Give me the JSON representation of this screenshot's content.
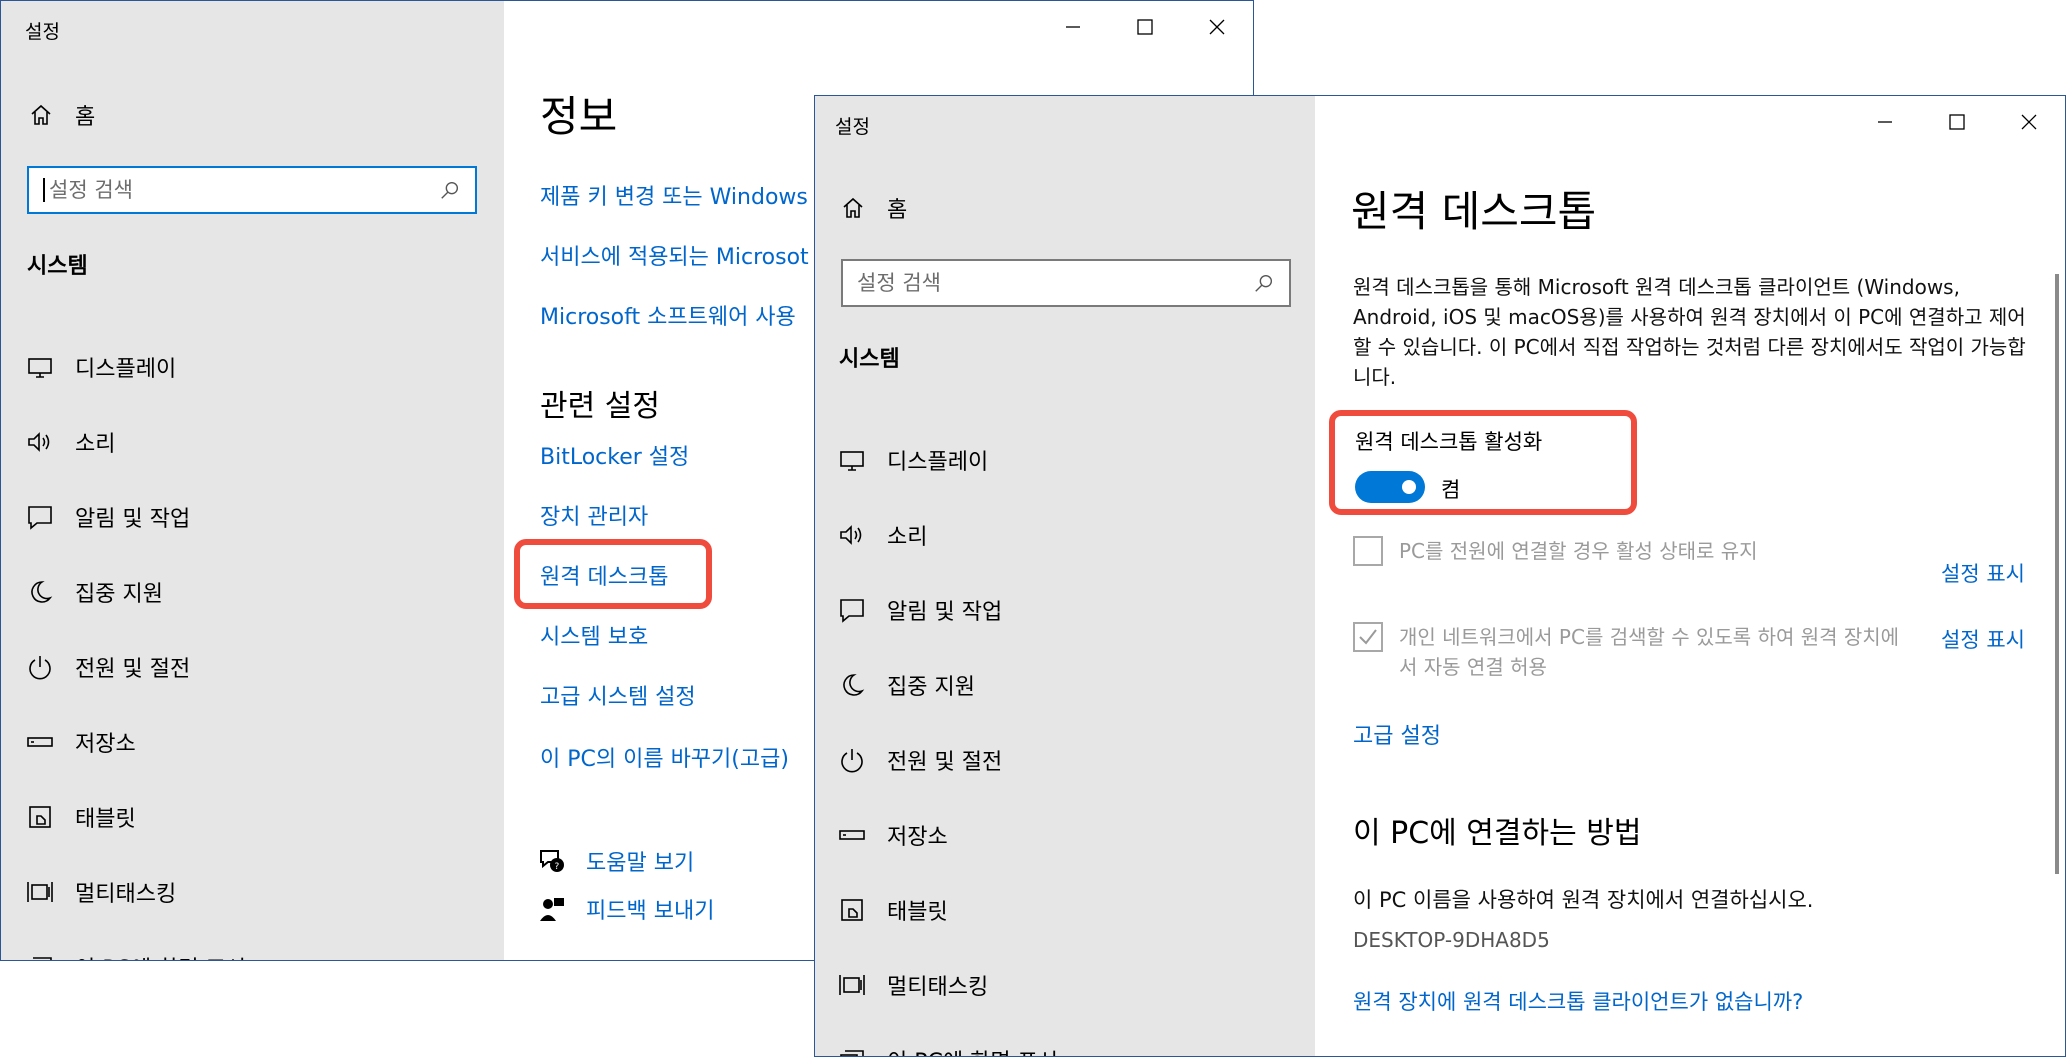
{
  "back_window": {
    "title": "설정",
    "home_label": "홈",
    "search_placeholder": "설정 검색",
    "section_label": "시스템",
    "nav_items": [
      {
        "label": "디스플레이",
        "icon": "display-icon"
      },
      {
        "label": "소리",
        "icon": "speaker-icon"
      },
      {
        "label": "알림 및 작업",
        "icon": "notification-icon"
      },
      {
        "label": "집중 지원",
        "icon": "moon-icon"
      },
      {
        "label": "전원 및 절전",
        "icon": "power-icon"
      },
      {
        "label": "저장소",
        "icon": "storage-icon"
      },
      {
        "label": "태블릿",
        "icon": "tablet-icon"
      },
      {
        "label": "멀티태스킹",
        "icon": "multitasking-icon"
      },
      {
        "label": "이 PC에 화면 표시",
        "icon": "project-icon"
      }
    ],
    "page_title": "정보",
    "top_links": [
      "제품 키 변경 또는 Windows",
      "서비스에 적용되는 Microsot",
      "Microsoft 소프트웨어 사용"
    ],
    "related_heading": "관련 설정",
    "related_links": [
      "BitLocker 설정",
      "장치 관리자",
      "원격 데스크톱",
      "시스템 보호",
      "고급 시스템 설정",
      "이 PC의 이름 바꾸기(고급)"
    ],
    "help_link": "도움말 보기",
    "feedback_link": "피드백 보내기"
  },
  "front_window": {
    "title": "설정",
    "home_label": "홈",
    "search_placeholder": "설정 검색",
    "section_label": "시스템",
    "nav_items": [
      {
        "label": "디스플레이",
        "icon": "display-icon"
      },
      {
        "label": "소리",
        "icon": "speaker-icon"
      },
      {
        "label": "알림 및 작업",
        "icon": "notification-icon"
      },
      {
        "label": "집중 지원",
        "icon": "moon-icon"
      },
      {
        "label": "전원 및 절전",
        "icon": "power-icon"
      },
      {
        "label": "저장소",
        "icon": "storage-icon"
      },
      {
        "label": "태블릿",
        "icon": "tablet-icon"
      },
      {
        "label": "멀티태스킹",
        "icon": "multitasking-icon"
      },
      {
        "label": "이 PC에 화면 표시",
        "icon": "project-icon"
      }
    ],
    "page_title": "원격 데스크톱",
    "description": "원격 데스크톱을 통해 Microsoft 원격 데스크톱 클라이언트 (Windows, Android, iOS 및 macOS용)를 사용하여 원격 장치에서 이 PC에 연결하고 제어할 수 있습니다. 이 PC에서 직접 작업하는 것처럼 다른 장치에서도 작업이 가능합니다.",
    "toggle_label": "원격 데스크톱 활성화",
    "toggle_state": "켬",
    "toggle_on": true,
    "checkbox1_label": "PC를 전원에 연결할 경우 활성 상태로 유지",
    "checkbox1_checked": false,
    "checkbox2_label": "개인 네트워크에서 PC를 검색할 수 있도록 하여 원격 장치에서 자동 연결 허용",
    "checkbox2_checked": true,
    "show_settings_1": "설정 표시",
    "show_settings_2": "설정 표시",
    "advanced_link": "고급 설정",
    "connect_heading": "이 PC에 연결하는 방법",
    "connect_text": "이 PC 이름을 사용하여 원격 장치에서 연결하십시오.",
    "pc_name": "DESKTOP-9DHA8D5",
    "no_client_link": "원격 장치에 원격 데스크톱 클라이언트가 없습니까?"
  },
  "colors": {
    "accent": "#0078d7",
    "link": "#0066cc",
    "highlight": "#f04c3e",
    "sidebar": "#e6e6e6"
  }
}
